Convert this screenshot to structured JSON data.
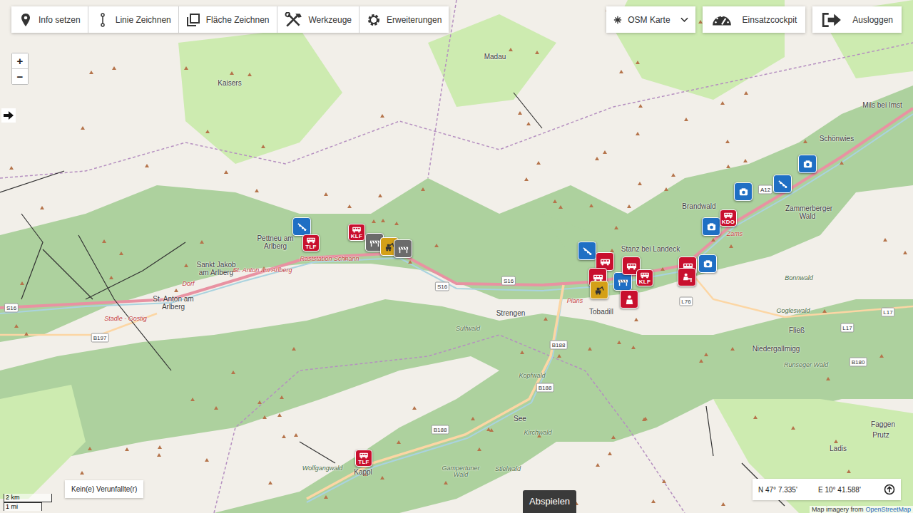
{
  "toolbar": {
    "tools": [
      "Info setzen",
      "Linie Zeichnen",
      "Fläche Zeichnen",
      "Werkzeuge",
      "Erweiterungen"
    ],
    "layer_select": {
      "label": "OSM Karte",
      "expanded": false
    },
    "actions": [
      "Einsatzcockpit",
      "Ausloggen"
    ]
  },
  "zoom": [
    "+",
    "−"
  ],
  "places": [
    "Madau",
    "Kaisers",
    "Mils bei Imst",
    "Schönwies",
    "Brandwald",
    "Zams",
    "Zammerberger Wald",
    "Stanz bei Landeck",
    "Pettneu am Arlberg",
    "Sankt Jakob am Arlberg",
    "St. Anton am Arlberg",
    "Dorf",
    "Stadle - Gostig",
    "Raststation Schnann",
    "Strengen",
    "Pians",
    "Tobadill",
    "Sulfwald",
    "Kopfwald",
    "See",
    "Kirchwald",
    "Gampertuner Wald",
    "Stielwald",
    "Wolfgangwald",
    "Kappl",
    "Fließ",
    "Gogleswald",
    "Niedergallmigg",
    "Runseger Wald",
    "Bonnwald",
    "Faggen",
    "Prutz",
    "Ladis",
    "St. Anton am Arlberg"
  ],
  "roads": [
    "A12",
    "S16",
    "S16",
    "B197",
    "B188",
    "B188",
    "B188",
    "L76",
    "L17",
    "L17",
    "B180",
    "S16"
  ],
  "pins": [
    {
      "kind": "sensor",
      "label": "",
      "color": "#1f6fc4"
    },
    {
      "kind": "vehicle",
      "label": "TLF",
      "color": "#c8102e"
    },
    {
      "kind": "vehicle",
      "label": "KLF",
      "color": "#c8102e"
    },
    {
      "kind": "barrier",
      "label": "",
      "color": "#6b6b6b"
    },
    {
      "kind": "excavator",
      "label": "",
      "color": "#d4a017"
    },
    {
      "kind": "barrier",
      "label": "",
      "color": "#6b6b6b"
    },
    {
      "kind": "sensor",
      "label": "",
      "color": "#1f6fc4"
    },
    {
      "kind": "vehicle",
      "label": "",
      "color": "#c8102e"
    },
    {
      "kind": "vehicle",
      "label": "",
      "color": "#c8102e"
    },
    {
      "kind": "excavator",
      "label": "",
      "color": "#d4a017"
    },
    {
      "kind": "barrier",
      "label": "",
      "color": "#1f6fc4"
    },
    {
      "kind": "vehicle",
      "label": "",
      "color": "#c8102e"
    },
    {
      "kind": "vehicle",
      "label": "KLF",
      "color": "#c8102e"
    },
    {
      "kind": "person",
      "label": "",
      "color": "#c8102e"
    },
    {
      "kind": "vehicle",
      "label": "",
      "color": "#c8102e"
    },
    {
      "kind": "command",
      "label": "",
      "color": "#c8102e"
    },
    {
      "kind": "camera",
      "label": "",
      "color": "#1f6fc4"
    },
    {
      "kind": "camera",
      "label": "",
      "color": "#1f6fc4"
    },
    {
      "kind": "vehicle",
      "label": "KDO",
      "color": "#c8102e"
    },
    {
      "kind": "camera",
      "label": "",
      "color": "#1f6fc4"
    },
    {
      "kind": "sensor",
      "label": "",
      "color": "#1f6fc4"
    },
    {
      "kind": "camera",
      "label": "",
      "color": "#1f6fc4"
    },
    {
      "kind": "vehicle",
      "label": "TLF",
      "color": "#c8102e"
    }
  ],
  "scale": {
    "metric": "2 km",
    "imperial": "1 mi"
  },
  "status": "Kein(e) Verunfallte(r)",
  "play_button": "Abspielen",
  "coordinates": {
    "lat": "N 47° 7.335'",
    "lon": "E 10° 41.588'"
  },
  "attribution": {
    "text": "Map imagery from",
    "link": "OpenStreetMap"
  }
}
